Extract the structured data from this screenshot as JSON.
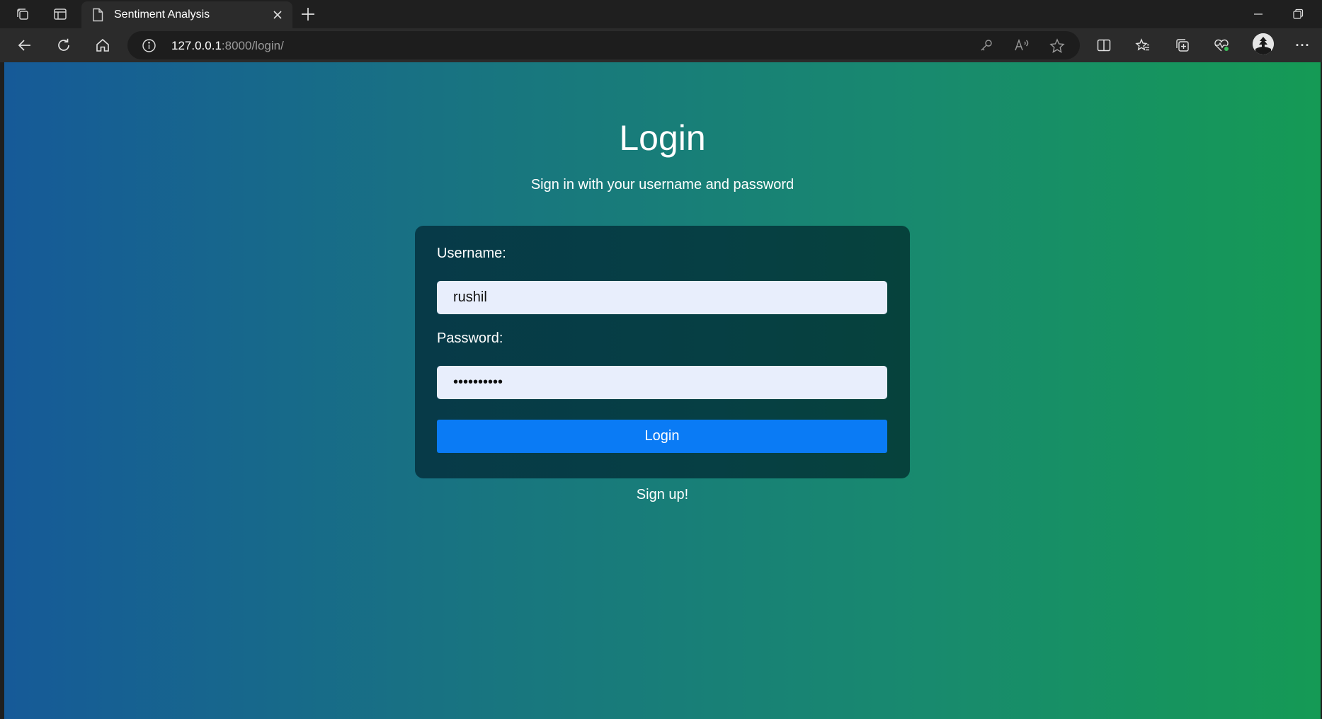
{
  "browser": {
    "tab": {
      "title": "Sentiment Analysis"
    },
    "address": {
      "host": "127.0.0.1",
      "path": ":8000/login/"
    },
    "menu_glyph": "···"
  },
  "page": {
    "title": "Login",
    "subtitle": "Sign in with your username and password",
    "form": {
      "username_label": "Username:",
      "username_value": "rushil",
      "password_label": "Password:",
      "password_value": "••••••••••",
      "submit_label": "Login"
    },
    "signup_link": "Sign up!"
  },
  "colors": {
    "gradient_start": "#165a98",
    "gradient_end": "#159a55",
    "button": "#0a7bf5",
    "input_bg": "#e8eefc"
  }
}
